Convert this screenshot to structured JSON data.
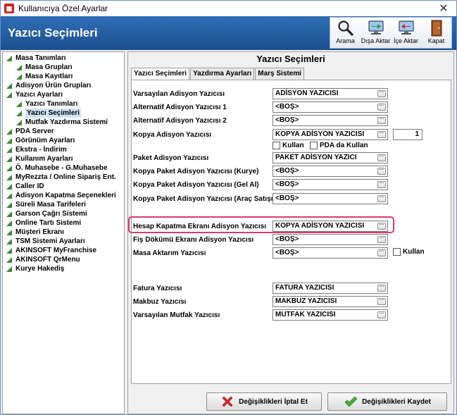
{
  "window": {
    "title": "Kullanıcıya Özel Ayarlar"
  },
  "header": {
    "title": "Yazıcı Seçimleri"
  },
  "toolbar": [
    {
      "label": "Arama",
      "icon": "magnifier-icon"
    },
    {
      "label": "Dışa Aktar",
      "icon": "export-monitor-icon"
    },
    {
      "label": "İçe Aktar",
      "icon": "import-monitor-icon"
    },
    {
      "label": "Kapat",
      "icon": "exit-door-icon"
    }
  ],
  "tree": [
    {
      "label": "Masa Tanımları",
      "level": 1
    },
    {
      "label": "Masa Grupları",
      "level": 2
    },
    {
      "label": "Masa Kayıtları",
      "level": 2
    },
    {
      "label": "Adisyon Ürün Grupları",
      "level": 1
    },
    {
      "label": "Yazıcı Ayarları",
      "level": 1
    },
    {
      "label": "Yazıcı Tanımları",
      "level": 2
    },
    {
      "label": "Yazıcı Seçimleri",
      "level": 2,
      "selected": true
    },
    {
      "label": "Mutfak Yazdırma Sistemi",
      "level": 2
    },
    {
      "label": "PDA Server",
      "level": 1
    },
    {
      "label": "Görünüm Ayarları",
      "level": 1
    },
    {
      "label": "Ekstra - İndirim",
      "level": 1
    },
    {
      "label": "Kullanım Ayarları",
      "level": 1
    },
    {
      "label": "Ö. Muhasebe - G.Muhasebe",
      "level": 1
    },
    {
      "label": "MyRezzta / Online Sipariş Ent.",
      "level": 1
    },
    {
      "label": "Caller ID",
      "level": 1
    },
    {
      "label": "Adisyon Kapatma Seçenekleri",
      "level": 1
    },
    {
      "label": "Süreli Masa Tarifeleri",
      "level": 1
    },
    {
      "label": "Garson Çağrı Sistemi",
      "level": 1
    },
    {
      "label": "Online Tartı Sistemi",
      "level": 1
    },
    {
      "label": "Müşteri Ekranı",
      "level": 1
    },
    {
      "label": "TSM Sistemi Ayarları",
      "level": 1
    },
    {
      "label": "AKINSOFT MyFranchise",
      "level": 1
    },
    {
      "label": "AKINSOFT QrMenu",
      "level": 1
    },
    {
      "label": "Kurye Hakediş",
      "level": 1
    }
  ],
  "panel": {
    "title": "Yazıcı Seçimleri",
    "tabs": [
      "Yazıcı Seçimleri",
      "Yazdırma Ayarları",
      "Marş Sistemi"
    ]
  },
  "rows": [
    {
      "label": "Varsayılan Adisyon Yazıcısı",
      "value": "ADİSYON YAZICISI"
    },
    {
      "label": "Alternatif Adisyon Yazıcısı 1",
      "value": "<BOŞ>"
    },
    {
      "label": "Alternatif Adisyon Yazıcısı 2",
      "value": "<BOŞ>"
    },
    {
      "label": "Kopya Adisyon Yazıcısı",
      "value": "KOPYA ADİSYON YAZICISI"
    },
    {
      "label": "Paket Adisyon Yazıcısı",
      "value": "PAKET ADİSYON YAZICI"
    },
    {
      "label": "Kopya Paket Adisyon Yazıcısı (Kurye)",
      "value": "<BOŞ>"
    },
    {
      "label": "Kopya Paket Adisyon Yazıcısı (Gel Al)",
      "value": "<BOŞ>"
    },
    {
      "label": "Kopya Paket Adisyon Yazıcısı (Araç Satışı)",
      "value": "<BOŞ>"
    },
    {
      "label": "Hesap Kapatma Ekranı Adisyon Yazıcısı",
      "value": "KOPYA ADİSYON YAZICISI"
    },
    {
      "label": "Fiş Dökümü Ekranı Adisyon Yazıcısı",
      "value": "<BOŞ>"
    },
    {
      "label": "Masa Aktarım Yazıcısı",
      "value": "<BOŞ>"
    },
    {
      "label": "Fatura Yazıcısı",
      "value": "FATURA YAZICISI"
    },
    {
      "label": "Makbuz Yazıcısı",
      "value": "MAKBUZ YAZICISI"
    },
    {
      "label": "Varsayılan Mutfak Yazıcısı",
      "value": "MUTFAK YAZICISI"
    }
  ],
  "copy_count": "1",
  "checks": {
    "kullan": "Kullan",
    "pda_da_kullan": "PDA da Kullan",
    "masa_kullan": "Kullan"
  },
  "buttons": {
    "cancel": "Değişiklikleri İptal Et",
    "save": "Değişiklikleri Kaydet"
  },
  "colors": {
    "header": "#2f6fb6",
    "highlight": "#d83a6e",
    "tree_arrow": "#3a8a2e"
  }
}
